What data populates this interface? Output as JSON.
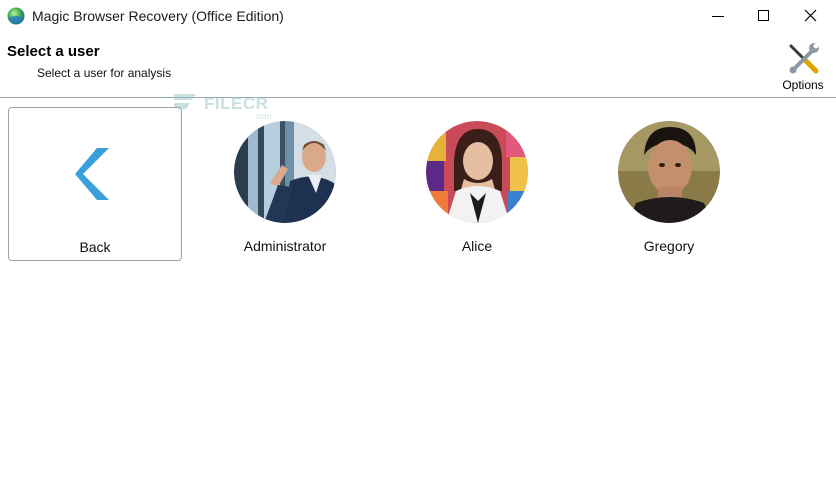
{
  "window": {
    "title": "Magic Browser Recovery (Office Edition)",
    "controls": [
      "minimize",
      "maximize",
      "close"
    ]
  },
  "header": {
    "title": "Select a user",
    "subtitle": "Select a user for analysis",
    "options_label": "Options"
  },
  "watermark": {
    "text": "FILECR",
    "sub": ".com"
  },
  "users": [
    {
      "label": "Back",
      "icon": "back-arrow-icon"
    },
    {
      "label": "Administrator",
      "icon": "admin-avatar"
    },
    {
      "label": "Alice",
      "icon": "alice-avatar"
    },
    {
      "label": "Gregory",
      "icon": "gregory-avatar"
    }
  ],
  "colors": {
    "accent": "#3aa0dc",
    "divider": "#9aa7b4"
  }
}
